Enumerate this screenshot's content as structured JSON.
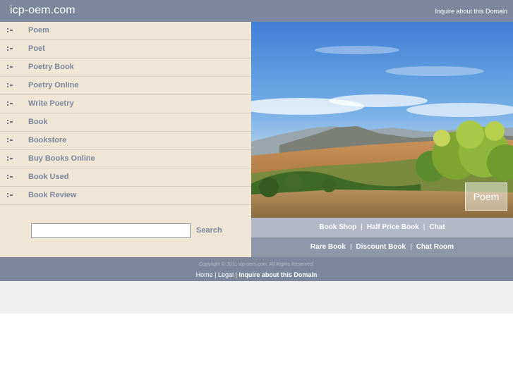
{
  "header": {
    "site_title": "icp-oem.com",
    "inquire_link": "Inquire about this Domain"
  },
  "menu": {
    "items": [
      {
        "label": "Poem"
      },
      {
        "label": "Poet"
      },
      {
        "label": "Poetry Book"
      },
      {
        "label": "Poetry Online"
      },
      {
        "label": "Write Poetry"
      },
      {
        "label": "Book"
      },
      {
        "label": "Bookstore"
      },
      {
        "label": "Buy Books Online"
      },
      {
        "label": "Book Used"
      },
      {
        "label": "Book Review"
      }
    ]
  },
  "search": {
    "value": "",
    "button_label": "Search"
  },
  "hero": {
    "badge_label": "Poem"
  },
  "links_row_1": {
    "items": [
      "Book Shop",
      "Half Price Book",
      "Chat"
    ],
    "separator": "|"
  },
  "links_row_2": {
    "items": [
      "Rare Book",
      "Discount Book",
      "Chat Room"
    ],
    "separator": "|"
  },
  "footer": {
    "copyright": "Copyright © 2011 icp-oem.com. All Rights Reserved.",
    "home": "Home",
    "legal": "Legal",
    "inquire": "Inquire about this Domain",
    "separator": "|"
  },
  "colors": {
    "header_bg": "#7c879e",
    "sidebar_bg": "#efe6d6",
    "link_row_1_bg": "#b2b8c5",
    "link_row_2_bg": "#8e96aa",
    "strip_bg": "#efefef"
  }
}
